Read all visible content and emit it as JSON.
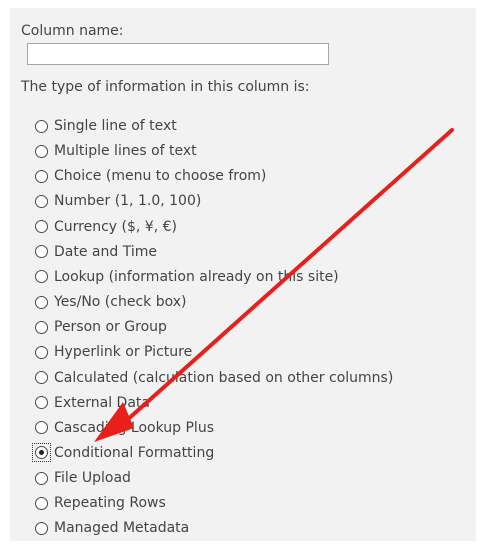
{
  "column_name": {
    "label": "Column name:",
    "value": "",
    "placeholder": ""
  },
  "type_section": {
    "label": "The type of information in this column is:",
    "selected": "Conditional Formatting",
    "options": [
      "Single line of text",
      "Multiple lines of text",
      "Choice (menu to choose from)",
      "Number (1, 1.0, 100)",
      "Currency ($, ¥, €)",
      "Date and Time",
      "Lookup (information already on this site)",
      "Yes/No (check box)",
      "Person or Group",
      "Hyperlink or Picture",
      "Calculated (calculation based on other columns)",
      "External Data",
      "Cascading Lookup Plus",
      "Conditional Formatting",
      "File Upload",
      "Repeating Rows",
      "Managed Metadata"
    ]
  },
  "annotation": {
    "arrow_color": "#e8201c",
    "points_to": "Conditional Formatting"
  }
}
